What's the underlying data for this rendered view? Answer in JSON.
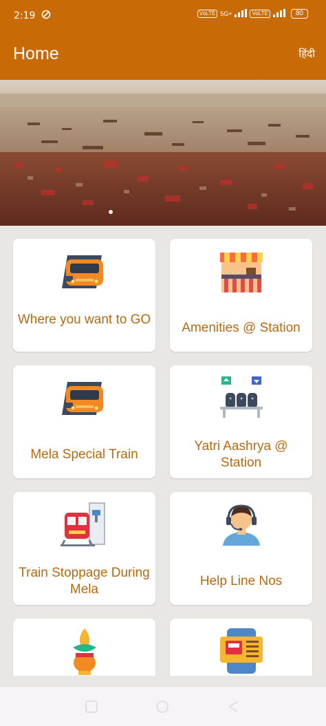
{
  "status_bar": {
    "time": "2:19",
    "signal1_tag": "VoLTE",
    "net1": "5G+",
    "signal2_tag": "VoLTE",
    "battery": "80"
  },
  "header": {
    "title": "Home",
    "language_toggle": "हिंदी"
  },
  "banner": {
    "slides": 2,
    "active_slide": 1
  },
  "tiles": [
    {
      "label": "Where you want to GO",
      "icon": "train-icon"
    },
    {
      "label": "Amenities @ Station",
      "icon": "food-stall-icon"
    },
    {
      "label": "Mela Special Train",
      "icon": "train-icon"
    },
    {
      "label": "Yatri Aashrya @ Station",
      "icon": "waiting-seats-icon"
    },
    {
      "label": "Train Stoppage During Mela",
      "icon": "train-platform-icon"
    },
    {
      "label": "Help Line Nos",
      "icon": "helpline-agent-icon"
    },
    {
      "label": "",
      "icon": "kalash-icon"
    },
    {
      "label": "",
      "icon": "ticket-machine-icon"
    }
  ],
  "colors": {
    "appbar": "#c86a06",
    "tile_label": "#b7690f",
    "background": "#e9e6e6"
  }
}
